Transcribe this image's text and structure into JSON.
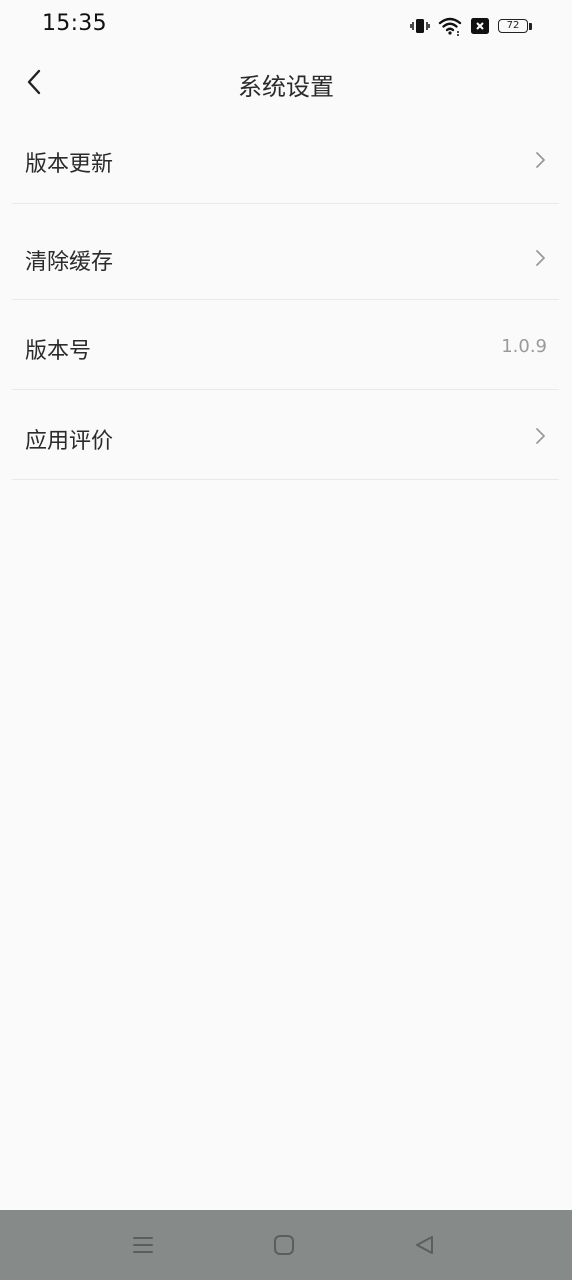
{
  "status_bar": {
    "time": "15:35",
    "battery_level": "72",
    "icons": [
      "vibrate-icon",
      "wifi-icon",
      "sim-error-icon",
      "battery-icon"
    ]
  },
  "header": {
    "title": "系统设置",
    "back_icon": "chevron-left-icon"
  },
  "settings": {
    "items": [
      {
        "label": "版本更新",
        "accessory": "chevron-right-icon"
      },
      {
        "label": "清除缓存",
        "accessory": "chevron-right-icon"
      },
      {
        "label": "版本号",
        "value": "1.0.9"
      },
      {
        "label": "应用评价",
        "accessory": "chevron-right-icon"
      }
    ]
  },
  "nav_bar": {
    "buttons": [
      "menu-icon",
      "home-icon",
      "back-triangle-icon"
    ]
  },
  "colors": {
    "background": "#fafafa",
    "nav_bar": "#868a89",
    "divider": "#e9e9e9",
    "secondary_text": "#9a9a9a"
  }
}
